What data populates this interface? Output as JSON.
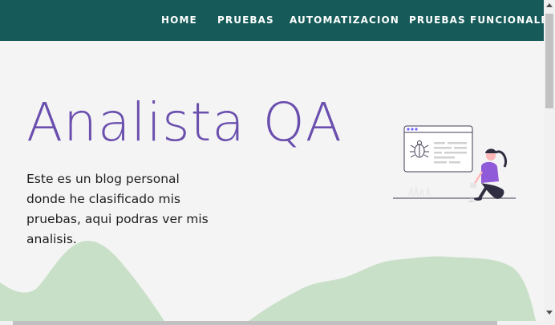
{
  "nav": {
    "items": [
      {
        "label": "HOME"
      },
      {
        "label": "PRUEBAS"
      },
      {
        "label": "AUTOMATIZACION"
      },
      {
        "label": "PRUEBAS FUNCIONALES"
      }
    ]
  },
  "hero": {
    "title": "Analista QA",
    "description": "Este es un blog personal donde he clasificado mis pruebas, aqui podras ver mis analisis."
  },
  "colors": {
    "navbar": "#165b59",
    "title": "#6a4fae",
    "hills": "#c9e0c8",
    "background": "#f4f4f4"
  },
  "icons": {
    "illustration": "bug-testing-illustration-icon"
  }
}
